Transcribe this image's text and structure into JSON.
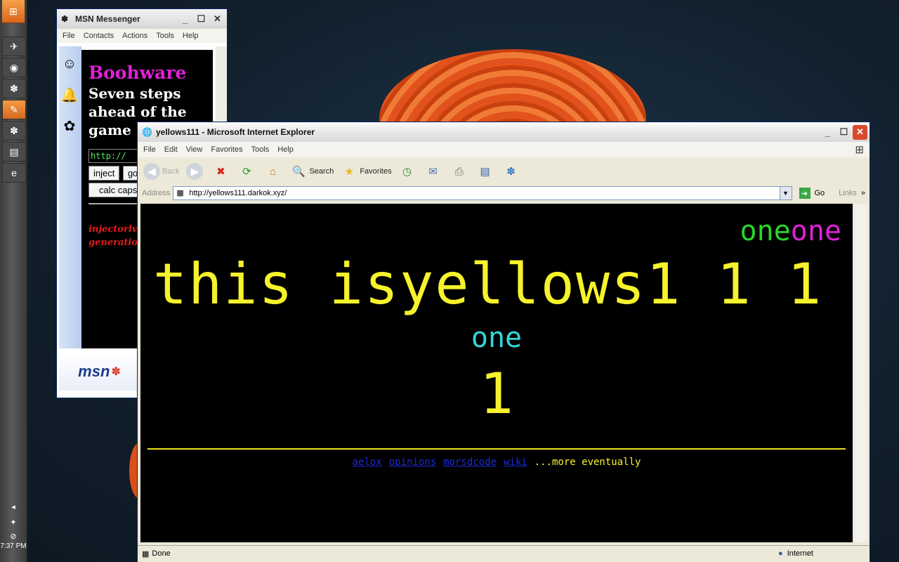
{
  "taskbar": {
    "clock": "7:37 PM"
  },
  "msn": {
    "title": "MSN Messenger",
    "menu": [
      "File",
      "Contacts",
      "Actions",
      "Tools",
      "Help"
    ],
    "ad": {
      "title": "Boohware",
      "subtitle": "Seven steps ahead of the game",
      "input_value": "http://",
      "buttons": [
        "inject",
        "go",
        "calc caps"
      ],
      "red_text_line1": "injectorlv2",
      "red_text_line2": "generation"
    },
    "logo": "msn"
  },
  "ie": {
    "title": "yellows111 - Microsoft Internet Explorer",
    "menu": [
      "File",
      "Edit",
      "View",
      "Favorites",
      "Tools",
      "Help"
    ],
    "toolbar": {
      "back": "Back",
      "search": "Search",
      "favorites": "Favorites"
    },
    "address": {
      "label": "Address",
      "url": "http://yellows111.darkok.xyz/",
      "go": "Go",
      "links": "Links"
    },
    "page": {
      "oneone_a": "one",
      "oneone_b": "one",
      "oneone_a_color": "#2ad52a",
      "oneone_b_color": "#e020d8",
      "headline": "this isyellows1 1 1",
      "one": "one",
      "one_big": "1",
      "links": [
        "aelox",
        "opinions",
        "morsdcode",
        "wiki"
      ],
      "more": "...more eventually"
    },
    "status": {
      "text": "Done",
      "zone": "Internet"
    }
  }
}
